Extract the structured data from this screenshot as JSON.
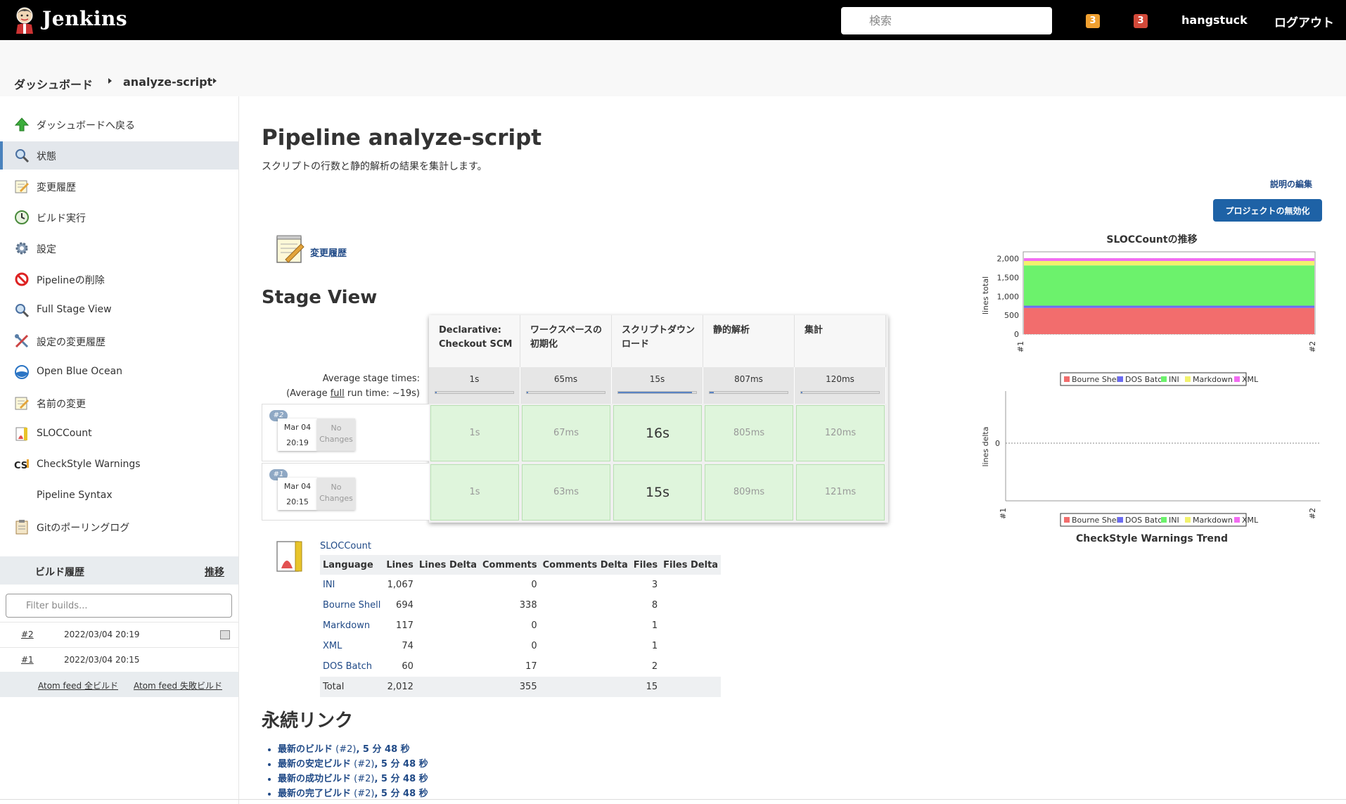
{
  "header": {
    "app_name": "Jenkins",
    "search_placeholder": "検索",
    "badge_orange": "3",
    "badge_red": "3",
    "username": "hangstuck",
    "logout": "ログアウト"
  },
  "breadcrumb": [
    "ダッシュボード",
    "analyze-script"
  ],
  "sidebar": {
    "tasks": [
      {
        "label": "ダッシュボードへ戻る",
        "icon": "up-arrow-icon"
      },
      {
        "label": "状態",
        "icon": "magnifier-icon"
      },
      {
        "label": "変更履歴",
        "icon": "notepad-icon"
      },
      {
        "label": "ビルド実行",
        "icon": "clock-icon"
      },
      {
        "label": "設定",
        "icon": "gear-icon"
      },
      {
        "label": "Pipelineの削除",
        "icon": "no-entry-icon"
      },
      {
        "label": "Full Stage View",
        "icon": "magnifier-icon"
      },
      {
        "label": "設定の変更履歴",
        "icon": "tools-icon"
      },
      {
        "label": "Open Blue Ocean",
        "icon": "blue-ocean-icon"
      },
      {
        "label": "名前の変更",
        "icon": "notepad-icon"
      },
      {
        "label": "SLOCCount",
        "icon": "sloccount-icon"
      },
      {
        "label": "CheckStyle Warnings",
        "icon": "checkstyle-icon"
      },
      {
        "label": "Pipeline Syntax",
        "icon": ""
      },
      {
        "label": "Gitのポーリングログ",
        "icon": "clipboard-icon"
      }
    ],
    "build_history": {
      "title": "ビルド履歴",
      "trend": "推移",
      "filter_placeholder": "Filter builds...",
      "builds": [
        {
          "number": "#2",
          "date": "2022/03/04 20:19"
        },
        {
          "number": "#1",
          "date": "2022/03/04 20:15"
        }
      ],
      "feed_all": "Atom feed 全ビルド",
      "feed_failed": "Atom feed 失敗ビルド"
    }
  },
  "main": {
    "title": "Pipeline analyze-script",
    "description": "スクリプトの行数と静的解析の結果を集計します。",
    "edit_description": "説明の編集",
    "disable_button": "プロジェクトの無効化",
    "changes_link": "変更履歴",
    "stage_view_title": "Stage View",
    "avg_stage_times": "Average stage times:",
    "avg_run_time_pre": "(Average ",
    "avg_run_time_full": "full",
    "avg_run_time_post": " run time: ~19s)",
    "stages": [
      {
        "name": "Declarative: Checkout SCM",
        "avg": "1s",
        "avg_fraction": 0.0
      },
      {
        "name": "ワークスペースの初期化",
        "avg": "65ms",
        "avg_fraction": 0.0
      },
      {
        "name": "スクリプトダウンロード",
        "avg": "15s",
        "avg_fraction": 0.95
      },
      {
        "name": "静的解析",
        "avg": "807ms",
        "avg_fraction": 0.05
      },
      {
        "name": "集計",
        "avg": "120ms",
        "avg_fraction": 0.0
      }
    ],
    "runs": [
      {
        "badge": "#2",
        "month_day": "Mar 04",
        "time": "20:19",
        "changes": "No Changes",
        "cells": [
          "1s",
          "67ms",
          "16s",
          "805ms",
          "120ms"
        ]
      },
      {
        "badge": "#1",
        "month_day": "Mar 04",
        "time": "20:15",
        "changes": "No Changes",
        "cells": [
          "1s",
          "63ms",
          "15s",
          "809ms",
          "121ms"
        ]
      }
    ],
    "sloccount": {
      "link": "SLOCCount",
      "headers": [
        "Language",
        "Lines",
        "Lines Delta",
        "Comments",
        "Comments Delta",
        "Files",
        "Files Delta"
      ],
      "rows": [
        {
          "language": "INI",
          "lines": "1,067",
          "lines_delta": "",
          "comments": "0",
          "comments_delta": "",
          "files": "3",
          "files_delta": ""
        },
        {
          "language": "Bourne Shell",
          "lines": "694",
          "lines_delta": "",
          "comments": "338",
          "comments_delta": "",
          "files": "8",
          "files_delta": ""
        },
        {
          "language": "Markdown",
          "lines": "117",
          "lines_delta": "",
          "comments": "0",
          "comments_delta": "",
          "files": "1",
          "files_delta": ""
        },
        {
          "language": "XML",
          "lines": "74",
          "lines_delta": "",
          "comments": "0",
          "comments_delta": "",
          "files": "1",
          "files_delta": ""
        },
        {
          "language": "DOS Batch",
          "lines": "60",
          "lines_delta": "",
          "comments": "17",
          "comments_delta": "",
          "files": "2",
          "files_delta": ""
        }
      ],
      "total": {
        "label": "Total",
        "lines": "2,012",
        "comments": "355",
        "files": "15"
      }
    },
    "permalinks_title": "永続リンク",
    "permalinks": [
      {
        "label": "最新のビルド",
        "num": " (#2)",
        "time": ", 5 分 48 秒"
      },
      {
        "label": "最新の安定ビルド",
        "num": " (#2)",
        "time": ", 5 分 48 秒"
      },
      {
        "label": "最新の成功ビルド",
        "num": " (#2)",
        "time": ", 5 分 48 秒"
      },
      {
        "label": "最新の完了ビルド",
        "num": " (#2)",
        "time": ", 5 分 48 秒"
      }
    ]
  },
  "chart_data": [
    {
      "type": "area",
      "title": "SLOCCountの推移",
      "xlabel": "",
      "ylabel": "lines total",
      "x": [
        "#1",
        "#2"
      ],
      "yticks": [
        "0",
        "500",
        "1,000",
        "1,500",
        "2,000"
      ],
      "ylim": [
        0,
        2050
      ],
      "grid": true,
      "legend": "bottom",
      "series": [
        {
          "name": "Bourne Shell",
          "color": "#f26d6d",
          "values": [
            694,
            694
          ]
        },
        {
          "name": "DOS Batch",
          "color": "#6b6bf2",
          "values": [
            60,
            60
          ]
        },
        {
          "name": "INI",
          "color": "#6cf26c",
          "values": [
            1067,
            1067
          ]
        },
        {
          "name": "Markdown",
          "color": "#f2f26c",
          "values": [
            117,
            117
          ]
        },
        {
          "name": "XML",
          "color": "#f26cf2",
          "values": [
            74,
            74
          ]
        }
      ]
    },
    {
      "type": "line",
      "title": "CheckStyle Warnings Trend",
      "xlabel": "",
      "ylabel": "lines delta",
      "x": [
        "#1",
        "#2"
      ],
      "yticks": [
        "0"
      ],
      "grid": true,
      "legend": "bottom",
      "series": [
        {
          "name": "Bourne Shell",
          "color": "#f26d6d",
          "values": [
            0,
            0
          ]
        },
        {
          "name": "DOS Batch",
          "color": "#6b6bf2",
          "values": [
            0,
            0
          ]
        },
        {
          "name": "INI",
          "color": "#6cf26c",
          "values": [
            0,
            0
          ]
        },
        {
          "name": "Markdown",
          "color": "#f2f26c",
          "values": [
            0,
            0
          ]
        },
        {
          "name": "XML",
          "color": "#f26cf2",
          "values": [
            0,
            0
          ]
        }
      ]
    }
  ]
}
